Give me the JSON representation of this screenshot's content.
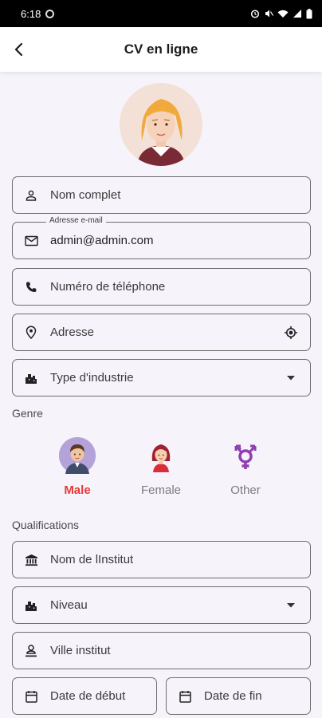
{
  "status": {
    "time": "6:18"
  },
  "app_bar": {
    "title": "CV en ligne"
  },
  "form": {
    "full_name": {
      "placeholder": "Nom complet"
    },
    "email": {
      "label": "Adresse e-mail",
      "value": "admin@admin.com"
    },
    "phone": {
      "placeholder": "Numéro de téléphone"
    },
    "address": {
      "placeholder": "Adresse"
    },
    "industry": {
      "placeholder": "Type d'industrie"
    }
  },
  "gender": {
    "label": "Genre",
    "options": [
      {
        "label": "Male",
        "selected": true
      },
      {
        "label": "Female",
        "selected": false
      },
      {
        "label": "Other",
        "selected": false
      }
    ]
  },
  "qualifications": {
    "label": "Qualifications",
    "institute": {
      "placeholder": "Nom de lInstitut"
    },
    "level": {
      "placeholder": "Niveau"
    },
    "city": {
      "placeholder": "Ville institut"
    },
    "start_date": {
      "placeholder": "Date de début"
    },
    "end_date": {
      "placeholder": "Date de fin"
    }
  },
  "colors": {
    "accent_selected": "#e53935",
    "background": "#f6f3fb",
    "other_symbol": "#8e3fb0"
  }
}
